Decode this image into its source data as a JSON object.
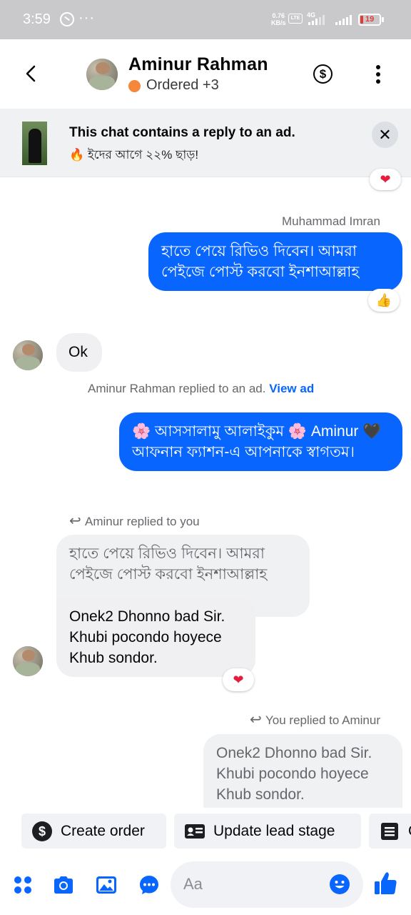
{
  "status_bar": {
    "time": "3:59",
    "dots": "···",
    "net_speed_top": "0.76",
    "net_speed_unit": "KB/s",
    "volte": "Vo LTE",
    "network": "4G",
    "battery": "19"
  },
  "header": {
    "contact_name": "Aminur Rahman",
    "status": "Ordered +3"
  },
  "ad_banner": {
    "title": "This chat contains a reply to an ad.",
    "subtitle": "🔥 ইদের আগে ২২% ছাড়!"
  },
  "messages": {
    "sender_label_1": "Muhammad Imran",
    "out_1": "হাতে পেয়ে রিভিও দিবেন। আমরা পেইজে পোস্ট করবো ইনশাআল্লাহ",
    "out_1_reaction": "👍",
    "in_1": "Ok",
    "ad_reply_text": "Aminur Rahman replied to an ad.",
    "ad_reply_link": "View ad",
    "out_2": "🌸 আসসালামু আলাইকুম 🌸 Aminur 🖤 আফনান ফ্যাশন-এ আপনাকে স্বাগতম।",
    "reply_label_1": "Aminur replied to you",
    "quote_1": "হাতে পেয়ে রিভিও দিবেন। আমরা পেইজে পোস্ট করবো ইনশাআল্লাহ",
    "in_2": "Onek2 Dhonno bad Sir. Khubi pocondo hoyece Khub sondor.",
    "in_2_reaction": "❤",
    "top_reaction": "❤",
    "reply_label_2": "You replied to Aminur",
    "quote_2": "Onek2 Dhonno bad Sir. Khubi pocondo hoyece Khub sondor."
  },
  "chips": {
    "create_order": "Create order",
    "update_lead_stage": "Update lead stage",
    "third": "C"
  },
  "composer": {
    "placeholder": "Aa"
  },
  "colors": {
    "accent": "#0866ff",
    "status_dot": "#f5873a",
    "heart": "#e41e3f"
  }
}
